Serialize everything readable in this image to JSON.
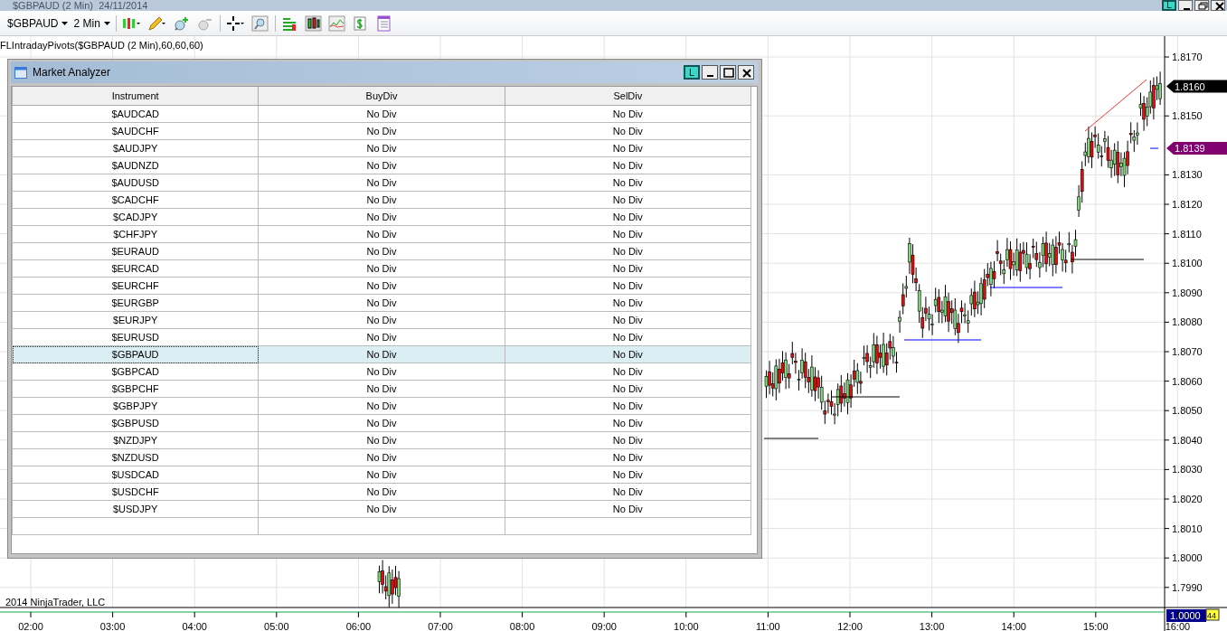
{
  "window": {
    "title": "$GBPAUD (2 Min)  24/11/2014",
    "link_label": "L"
  },
  "toolbar": {
    "instrument": "$GBPAUD",
    "interval": "2 Min"
  },
  "indicator_label": "FLIntradayPivots($GBPAUD (2 Min),60,60,60)",
  "market_analyzer": {
    "title": "Market Analyzer",
    "link_label": "L",
    "columns": [
      "Instrument",
      "BuyDiv",
      "SelDiv"
    ],
    "rows": [
      {
        "instrument": "$AUDCAD",
        "buy_div": "No Div",
        "sel_div": "No Div",
        "selected": false
      },
      {
        "instrument": "$AUDCHF",
        "buy_div": "No Div",
        "sel_div": "No Div",
        "selected": false
      },
      {
        "instrument": "$AUDJPY",
        "buy_div": "No Div",
        "sel_div": "No Div",
        "selected": false
      },
      {
        "instrument": "$AUDNZD",
        "buy_div": "No Div",
        "sel_div": "No Div",
        "selected": false
      },
      {
        "instrument": "$AUDUSD",
        "buy_div": "No Div",
        "sel_div": "No Div",
        "selected": false
      },
      {
        "instrument": "$CADCHF",
        "buy_div": "No Div",
        "sel_div": "No Div",
        "selected": false
      },
      {
        "instrument": "$CADJPY",
        "buy_div": "No Div",
        "sel_div": "No Div",
        "selected": false
      },
      {
        "instrument": "$CHFJPY",
        "buy_div": "No Div",
        "sel_div": "No Div",
        "selected": false
      },
      {
        "instrument": "$EURAUD",
        "buy_div": "No Div",
        "sel_div": "No Div",
        "selected": false
      },
      {
        "instrument": "$EURCAD",
        "buy_div": "No Div",
        "sel_div": "No Div",
        "selected": false
      },
      {
        "instrument": "$EURCHF",
        "buy_div": "No Div",
        "sel_div": "No Div",
        "selected": false
      },
      {
        "instrument": "$EURGBP",
        "buy_div": "No Div",
        "sel_div": "No Div",
        "selected": false
      },
      {
        "instrument": "$EURJPY",
        "buy_div": "No Div",
        "sel_div": "No Div",
        "selected": false
      },
      {
        "instrument": "$EURUSD",
        "buy_div": "No Div",
        "sel_div": "No Div",
        "selected": false
      },
      {
        "instrument": "$GBPAUD",
        "buy_div": "No Div",
        "sel_div": "No Div",
        "selected": true
      },
      {
        "instrument": "$GBPCAD",
        "buy_div": "No Div",
        "sel_div": "No Div",
        "selected": false
      },
      {
        "instrument": "$GBPCHF",
        "buy_div": "No Div",
        "sel_div": "No Div",
        "selected": false
      },
      {
        "instrument": "$GBPJPY",
        "buy_div": "No Div",
        "sel_div": "No Div",
        "selected": false
      },
      {
        "instrument": "$GBPUSD",
        "buy_div": "No Div",
        "sel_div": "No Div",
        "selected": false
      },
      {
        "instrument": "$NZDJPY",
        "buy_div": "No Div",
        "sel_div": "No Div",
        "selected": false
      },
      {
        "instrument": "$NZDUSD",
        "buy_div": "No Div",
        "sel_div": "No Div",
        "selected": false
      },
      {
        "instrument": "$USDCAD",
        "buy_div": "No Div",
        "sel_div": "No Div",
        "selected": false
      },
      {
        "instrument": "$USDCHF",
        "buy_div": "No Div",
        "sel_div": "No Div",
        "selected": false
      },
      {
        "instrument": "$USDJPY",
        "buy_div": "No Div",
        "sel_div": "No Div",
        "selected": false
      }
    ]
  },
  "chart": {
    "price_labels": [
      "1.8170",
      "1.8150",
      "1.8130",
      "1.8120",
      "1.8110",
      "1.8100",
      "1.8090",
      "1.8080",
      "1.8070",
      "1.8060",
      "1.8050",
      "1.8040",
      "1.8030",
      "1.8020",
      "1.8010",
      "1.8000",
      "1.7990"
    ],
    "last_price": "1.8160",
    "pivot_price": "1.8139",
    "time_labels": [
      "02:00",
      "03:00",
      "04:00",
      "05:00",
      "06:00",
      "07:00",
      "08:00",
      "09:00",
      "10:00",
      "11:00",
      "12:00",
      "13:00",
      "14:00",
      "15:00",
      "16:00"
    ],
    "copyright": "2014 NinjaTrader, LLC",
    "panel_value": "1.0000",
    "panel_count": "44"
  }
}
